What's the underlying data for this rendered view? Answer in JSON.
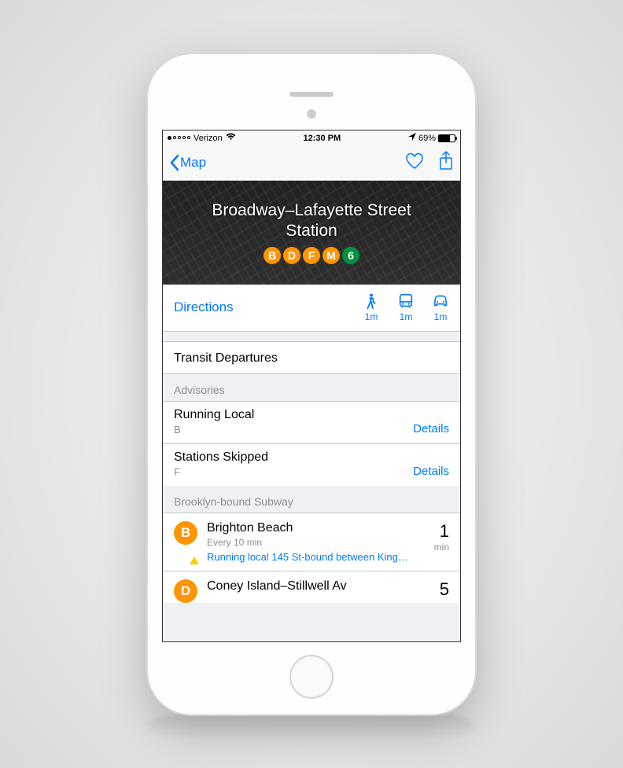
{
  "status": {
    "carrier": "Verizon",
    "time": "12:30 PM",
    "battery_pct": "69%"
  },
  "nav": {
    "back_label": "Map"
  },
  "hero": {
    "title_line1": "Broadway–Lafayette Street",
    "title_line2": "Station",
    "lines": [
      "B",
      "D",
      "F",
      "M",
      "6"
    ]
  },
  "directions": {
    "label": "Directions",
    "modes": [
      {
        "name": "walk",
        "time": "1m"
      },
      {
        "name": "transit",
        "time": "1m"
      },
      {
        "name": "drive",
        "time": "1m"
      }
    ]
  },
  "transit_header": "Transit Departures",
  "advisories_header": "Advisories",
  "advisories": [
    {
      "title": "Running Local",
      "line": "B",
      "details": "Details"
    },
    {
      "title": "Stations Skipped",
      "line": "F",
      "details": "Details"
    }
  ],
  "direction_header": "Brooklyn-bound Subway",
  "departures": [
    {
      "badge": "B",
      "destination": "Brighton Beach",
      "frequency": "Every 10 min",
      "note": "Running local 145 St-bound between King…",
      "time_value": "1",
      "time_unit": "min",
      "has_alert": true
    },
    {
      "badge": "D",
      "destination": "Coney Island–Stillwell Av",
      "time_value": "5"
    }
  ]
}
